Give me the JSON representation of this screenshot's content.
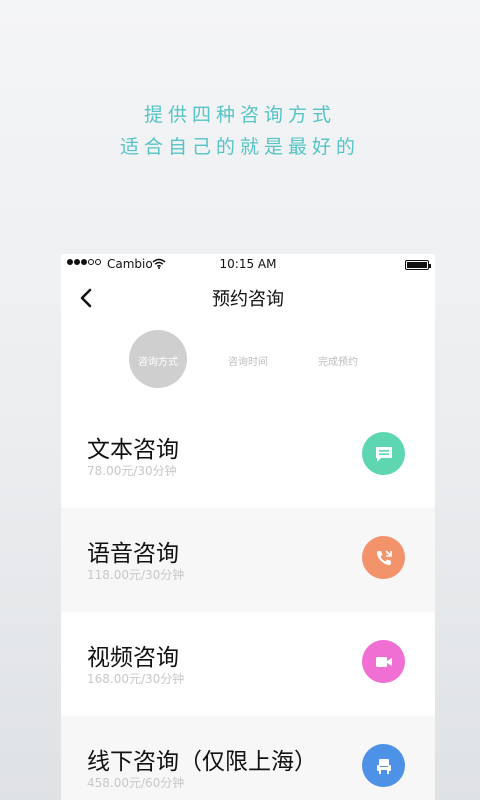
{
  "tagline": {
    "line1": "提供四种咨询方式",
    "line2": "适合自己的就是最好的"
  },
  "statusbar": {
    "carrier": "Cambio",
    "time": "10:15 AM"
  },
  "navbar": {
    "title": "预约咨询"
  },
  "steps": [
    {
      "label": "咨询方式",
      "active": true
    },
    {
      "label": "咨询时间",
      "active": false
    },
    {
      "label": "完成预约",
      "active": false
    }
  ],
  "options": [
    {
      "title": "文本咨询",
      "price": "78.00元/30分钟",
      "icon": "chat-icon",
      "color": "#5fd6b2"
    },
    {
      "title": "语音咨询",
      "price": "118.00元/30分钟",
      "icon": "phone-icon",
      "color": "#f2936c"
    },
    {
      "title": "视频咨询",
      "price": "168.00元/30分钟",
      "icon": "video-icon",
      "color": "#f06fd3"
    },
    {
      "title": "线下咨询（仅限上海）",
      "price": "458.00元/60分钟",
      "icon": "chair-icon",
      "color": "#4e92e8"
    }
  ],
  "colors": {
    "accent": "#56c4c6"
  }
}
